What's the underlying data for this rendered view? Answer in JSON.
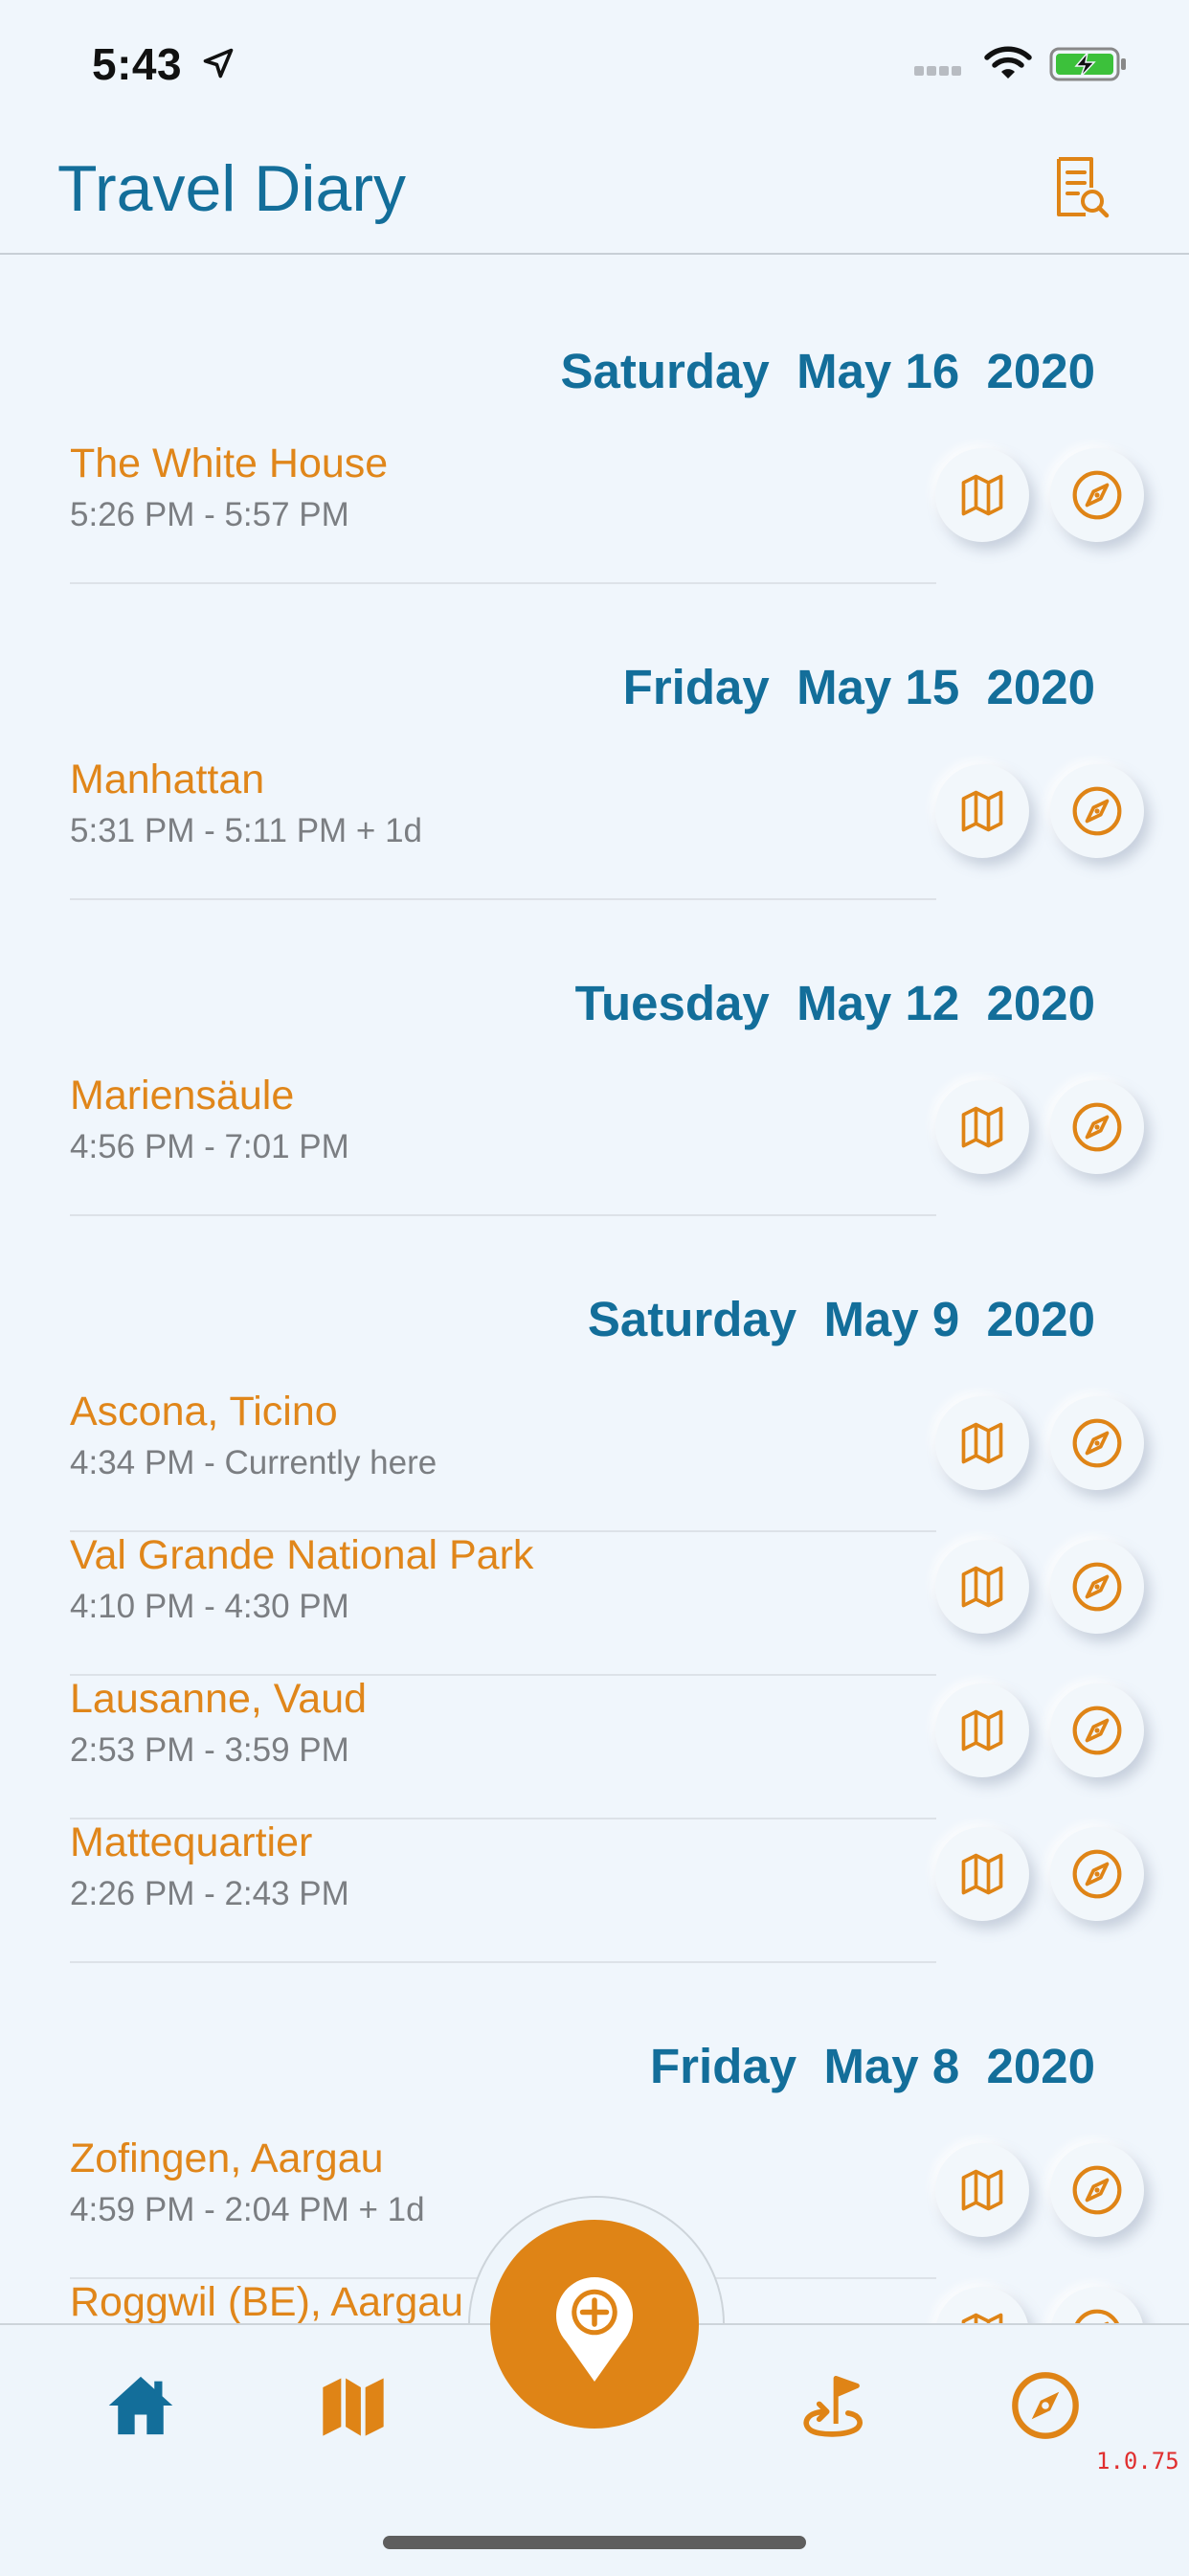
{
  "status_bar": {
    "time": "5:43"
  },
  "header": {
    "title": "Travel Diary"
  },
  "days": [
    {
      "weekday": "Saturday",
      "date": "May 16",
      "year": "2020",
      "entries": [
        {
          "place": "The White House",
          "time": "5:26 PM - 5:57 PM"
        }
      ]
    },
    {
      "weekday": "Friday",
      "date": "May 15",
      "year": "2020",
      "entries": [
        {
          "place": "Manhattan",
          "time": "5:31 PM - 5:11 PM + 1d"
        }
      ]
    },
    {
      "weekday": "Tuesday",
      "date": "May 12",
      "year": "2020",
      "entries": [
        {
          "place": "Mariensäule",
          "time": "4:56 PM - 7:01 PM"
        }
      ]
    },
    {
      "weekday": "Saturday",
      "date": "May 9",
      "year": "2020",
      "entries": [
        {
          "place": "Ascona, Ticino",
          "time": "4:34 PM - Currently here"
        },
        {
          "place": "Val Grande National Park",
          "time": "4:10 PM - 4:30 PM"
        },
        {
          "place": "Lausanne, Vaud",
          "time": "2:53 PM - 3:59 PM"
        },
        {
          "place": "Mattequartier",
          "time": "2:26 PM - 2:43 PM"
        }
      ]
    },
    {
      "weekday": "Friday",
      "date": "May 8",
      "year": "2020",
      "entries": [
        {
          "place": "Zofingen, Aargau",
          "time": "4:59 PM - 2:04 PM + 1d"
        },
        {
          "place": "Roggwil (BE), Aargau",
          "time": ""
        }
      ]
    }
  ],
  "tab_bar": {
    "tabs": [
      "home-icon",
      "map-icon",
      "add-location-icon",
      "flag-return-icon",
      "compass-icon"
    ],
    "active": "home"
  },
  "version": "1.0.75",
  "colors": {
    "accent": "#df8416",
    "primary": "#136e9a",
    "background": "#f0f6fc"
  }
}
